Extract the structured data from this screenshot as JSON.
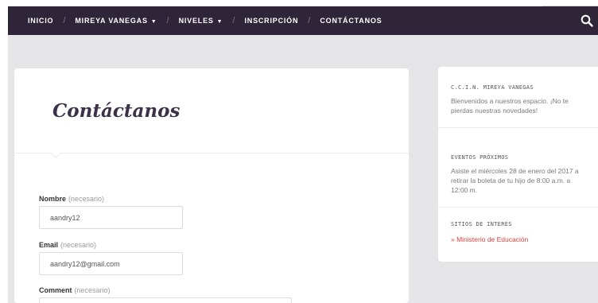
{
  "nav": {
    "items": [
      {
        "label": "INICIO",
        "dropdown": false
      },
      {
        "label": "MIREYA VANEGAS",
        "dropdown": true
      },
      {
        "label": "NIVELES",
        "dropdown": true
      },
      {
        "label": "INSCRIPCIÓN",
        "dropdown": false
      },
      {
        "label": "CONTÁCTANOS",
        "dropdown": false
      }
    ],
    "separator": "/",
    "dropdown_icon": "caret-down-icon",
    "search_icon": "search-icon"
  },
  "main": {
    "title": "Contáctanos",
    "fields": [
      {
        "label": "Nombre",
        "required_note": "(necesario)",
        "value": "aandry12"
      },
      {
        "label": "Email",
        "required_note": "(necesario)",
        "value": "aandry12@gmail.com"
      },
      {
        "label": "Comment",
        "required_note": "(necesario)",
        "value": ""
      }
    ]
  },
  "sidebar": {
    "widgets": [
      {
        "title": "C.C.I.N. MIREYA VANEGAS",
        "text": "Bienvenidos a nuestros espacio. ¡No te pierdas nuestras novedades!"
      },
      {
        "title": "EVENTOS PRÓXIMOS",
        "text": "Asiste el miércoles 28 de enero del 2017 a retirar la boleta de tu hijo de 8:00 a.m. a 12:00 m."
      },
      {
        "title": "SITIOS DE INTERÉS",
        "link": "» Ministerio de Educación"
      }
    ]
  },
  "colors": {
    "navbar": "#2e2538",
    "background": "#e5e4e6",
    "title": "#3d3049",
    "link": "#d9423b"
  }
}
